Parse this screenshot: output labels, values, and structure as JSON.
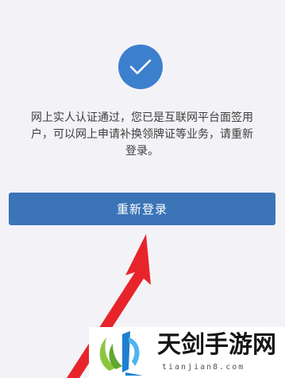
{
  "status": {
    "icon": "checkmark-icon",
    "icon_color": "#3c7fcd",
    "message_lines": [
      "网上实人认证通过，您已是互联网平台面签用",
      "户，可以网上申请补换领牌证等业务，请重新",
      "登录。"
    ]
  },
  "actions": {
    "relogin_label": "重新登录",
    "button_color": "#3b74b7"
  },
  "annotation": {
    "icon": "red-arrow-icon",
    "color": "#e8242b"
  },
  "watermark": {
    "icon": "site-logo",
    "name": "天剑手游网",
    "domain": "tianjian8.com"
  }
}
